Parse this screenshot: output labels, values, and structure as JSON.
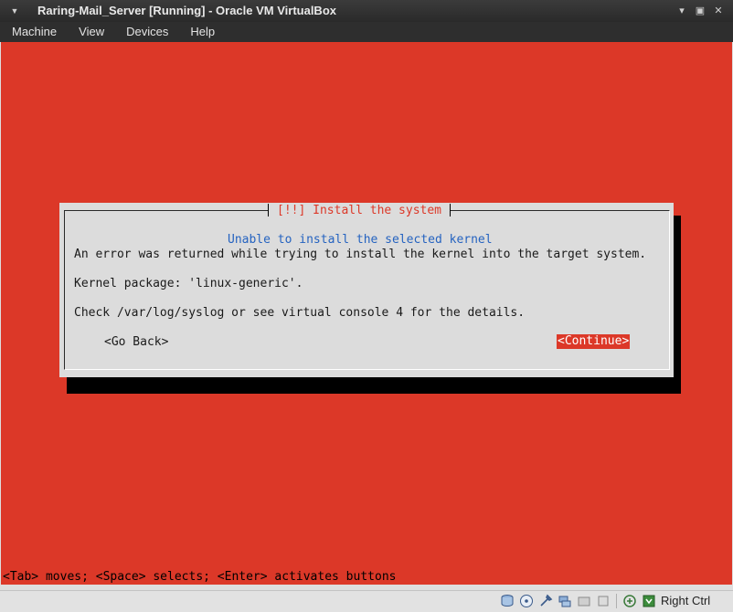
{
  "window": {
    "title": "Raring-Mail_Server [Running] - Oracle VM VirtualBox",
    "menu_glyph": "▼",
    "controls": {
      "minimize": "▾",
      "maximize": "▣",
      "close": "✕"
    }
  },
  "menubar": {
    "items": [
      {
        "label": "Machine"
      },
      {
        "label": "View"
      },
      {
        "label": "Devices"
      },
      {
        "label": "Help"
      }
    ]
  },
  "installer": {
    "dialog_title": "[!!] Install the system",
    "subtitle": "Unable to install the selected kernel",
    "line1": "An error was returned while trying to install the kernel into the target system.",
    "line2": "Kernel package: 'linux-generic'.",
    "line3": "Check /var/log/syslog or see virtual console 4 for the details.",
    "go_back": "<Go Back>",
    "continue": "<Continue>",
    "help_line": "<Tab> moves; <Space> selects; <Enter> activates buttons"
  },
  "statusbar": {
    "icons": [
      "hard-disk-icon",
      "optical-drive-icon",
      "usb-icon",
      "network-icon",
      "shared-folder-icon",
      "display-icon",
      "capture-icon",
      "mouse-integration-icon",
      "host-key-icon"
    ],
    "host_key_label": "Right Ctrl"
  },
  "colors": {
    "screen_background": "#dc3828",
    "dialog_background": "#dcdcdc",
    "subtitle": "#2563c0",
    "selected_button": "#dc3828"
  }
}
